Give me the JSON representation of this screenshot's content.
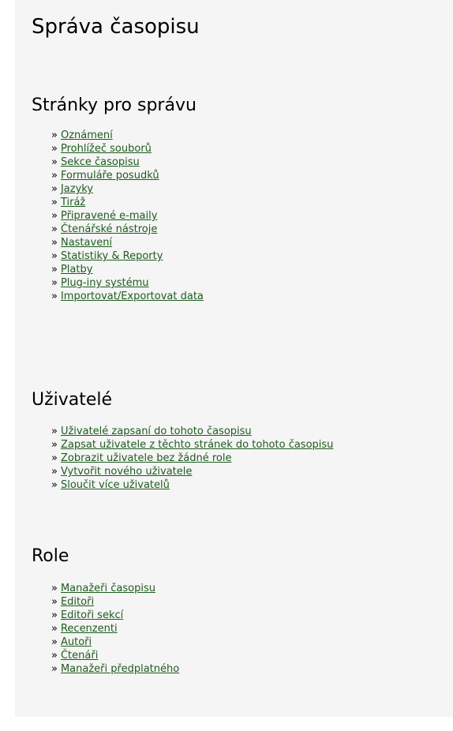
{
  "page_title": "Správa časopisu",
  "bullet": "»",
  "sections": [
    {
      "title": "Stránky pro správu",
      "links": [
        "Oznámení",
        "Prohlížeč souborů",
        "Sekce časopisu",
        "Formuláře posudků",
        "Jazyky",
        "Tiráž",
        "Připravené e-maily",
        "Čtenářské nástroje",
        "Nastavení",
        "Statistiky & Reporty",
        "Platby",
        "Plug-iny systému",
        "Importovat/Exportovat data"
      ]
    },
    {
      "title": "Uživatelé",
      "links": [
        "Uživatelé zapsaní do tohoto časopisu",
        "Zapsat uživatele z těchto stránek do tohoto časopisu",
        "Zobrazit uživatele bez žádné role",
        "Vytvořit nového uživatele",
        "Sloučit více uživatelů"
      ]
    },
    {
      "title": "Role",
      "links": [
        "Manažeři časopisu",
        "Editoři",
        "Editoři sekcí",
        "Recenzenti",
        "Autoři",
        "Čtenáři",
        "Manažeři předplatného"
      ]
    }
  ],
  "colors": {
    "link": "#1e5c1e",
    "panel_background": "#f5f5f5"
  }
}
